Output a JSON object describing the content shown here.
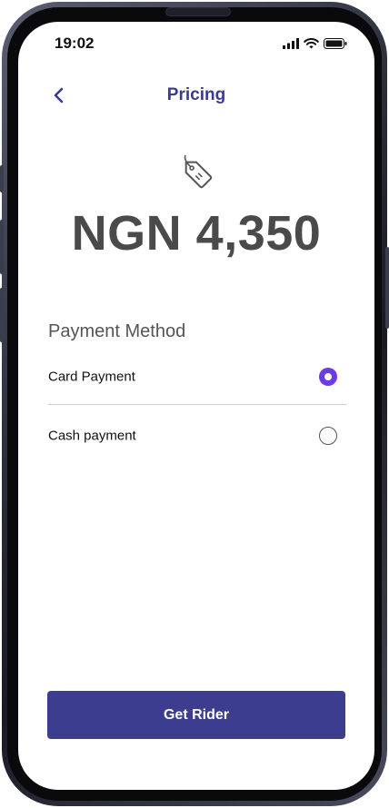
{
  "status_bar": {
    "time": "19:02"
  },
  "header": {
    "title": "Pricing"
  },
  "price": {
    "amount": "NGN 4,350"
  },
  "payment": {
    "section_title": "Payment Method",
    "options": [
      {
        "label": "Card Payment",
        "selected": true
      },
      {
        "label": "Cash payment",
        "selected": false
      }
    ]
  },
  "cta": {
    "label": "Get Rider"
  },
  "colors": {
    "accent": "#3d3d8f",
    "radio_selected": "#6a3be6",
    "price_text": "#4a4a4a"
  },
  "icons": [
    "back-arrow-icon",
    "price-tag-icon",
    "signal-icon",
    "wifi-icon",
    "battery-icon"
  ]
}
